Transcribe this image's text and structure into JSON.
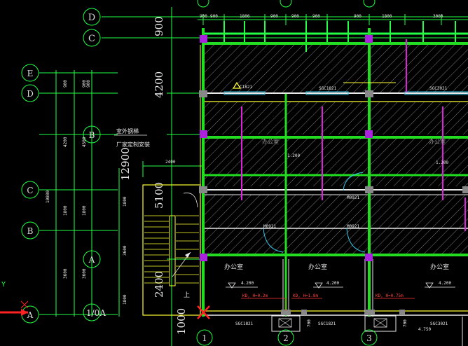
{
  "colors": {
    "background": "#000000",
    "wall": "#22dd22",
    "axis": "#22ff44",
    "dimension_text": "#e8e8e8",
    "yellow": "#ffff33",
    "magenta": "#dd22dd",
    "cyan": "#33ccee",
    "red": "#ff3333",
    "hatch": "#d8d8d8"
  },
  "grid_bubbles_top": {
    "d": "D",
    "c": "C"
  },
  "grid_bubbles_left": [
    "E",
    "D",
    "B",
    "C",
    "B",
    "A",
    "A"
  ],
  "grid_bubbles_bottom": [
    "1",
    "2",
    "3"
  ],
  "left_dims_column1": [
    "900",
    "4200",
    "10800",
    "1800",
    "3600"
  ],
  "left_dims_column2": [
    "900",
    "4500",
    "1800",
    "3600"
  ],
  "left_dims_column3": [
    "900"
  ],
  "big_dims": {
    "d900": "900",
    "d4200": "4200",
    "d12900": "12900",
    "d5100": "5100",
    "d2400": "2400",
    "d1000": "1000"
  },
  "top_dims": [
    "900",
    "900",
    "1800",
    "900",
    "900",
    "900",
    "900",
    "1800",
    "3000"
  ],
  "stair_dims": [
    "2400",
    "1800",
    "1800",
    "3600",
    "1800",
    "750",
    "750"
  ],
  "notes": {
    "outdoor_stair": "室外钢梯",
    "factory_install": "厂家定制安装",
    "up": "上",
    "axis_1_0a": "1/0A"
  },
  "rooms": [
    {
      "name": "办公室",
      "level": "4.200"
    },
    {
      "name": "办公室",
      "level": "4.200"
    },
    {
      "name": "办公室",
      "level": "4.200"
    }
  ],
  "window_tags": [
    "SGC1821",
    "SGC1821",
    "SGC1821",
    "SGC1821",
    "SGC3021"
  ],
  "window_tags_mid": [
    "C1821",
    "SGC1821",
    "SGC3021"
  ],
  "door_tags": [
    "M0921",
    "M0921",
    "M0921"
  ],
  "room_tag_small": [
    "办公室",
    "办公室"
  ],
  "small_dims_mid": [
    "1.200",
    "1.200"
  ],
  "outlet_tags": [
    "KD, H=0.2m",
    "KD, H=1.8m",
    "KD, H=0.75m"
  ],
  "level_small": "4.750",
  "small_700": [
    "700",
    "700"
  ],
  "ucs_axis_y": "Y"
}
